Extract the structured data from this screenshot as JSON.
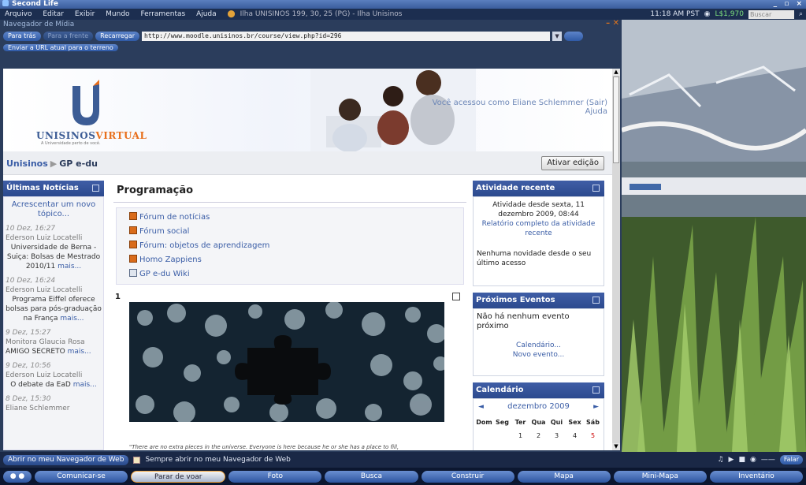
{
  "app": {
    "title": "Second Life",
    "window_controls": "_ ▫ ×"
  },
  "menubar": {
    "items": [
      "Arquivo",
      "Editar",
      "Exibir",
      "Mundo",
      "Ferramentas",
      "Ajuda"
    ],
    "location": "Ilha UNISINOS 199, 30, 25 (PG) - Ilha Unisinos",
    "time": "11:18 AM PST",
    "money": "L$1,970",
    "search_placeholder": "Buscar"
  },
  "media_browser": {
    "title": "Navegador de Mídia",
    "back": "Para trás",
    "forward": "Para a frente",
    "reload": "Recarregar",
    "url": "http://www.moodle.unisinos.br/course/view.php?id=296",
    "send_url": "Enviar a URL atual para o terreno"
  },
  "moodle": {
    "logo": "UNISINOS",
    "logo_accent": "VIRTUAL",
    "logo_sub": "A Universidade perto de você.",
    "user_line": "Você acessou como Eliane Schlemmer (Sair)",
    "help": "Ajuda",
    "breadcrumb_home": "Unisinos",
    "breadcrumb_sep": "▶",
    "breadcrumb_course": "GP e-du",
    "edit_button": "Ativar edição",
    "news": {
      "title": "Últimas Notícias",
      "add": "Acrescentar um novo tópico...",
      "items": [
        {
          "date": "10 Dez, 16:27",
          "author": "Ederson Luiz Locatelli",
          "text": "Universidade de Berna - Suiça: Bolsas de Mestrado 2010/11",
          "more": "mais..."
        },
        {
          "date": "10 Dez, 16:24",
          "author": "Ederson Luiz Locatelli",
          "text": "Programa Eiffel oferece bolsas para pós-graduação na França",
          "more": "mais..."
        },
        {
          "date": "9 Dez, 15:27",
          "author": "Monitora Glaucia Rosa",
          "text": "AMIGO SECRETO",
          "more": "mais..."
        },
        {
          "date": "9 Dez, 10:56",
          "author": "Ederson Luiz Locatelli",
          "text": "O debate da EaD",
          "more": "mais..."
        },
        {
          "date": "8 Dez, 15:30",
          "author": "Eliane Schlemmer",
          "text": "",
          "more": ""
        }
      ]
    },
    "main_title": "Programação",
    "forums": [
      "Fórum de notícias",
      "Fórum social",
      "Fórum: objetos de aprendizagem",
      "Homo Zappiens",
      "GP e-du Wiki"
    ],
    "section_number": "1",
    "quote": "\"There are no extra pieces in the universe. Everyone is here because he or she has a place to fill,",
    "recent": {
      "title": "Atividade recente",
      "since": "Atividade desde sexta, 11 dezembro 2009, 08:44",
      "full_report": "Relatório completo da atividade recente",
      "none": "Nenhuma novidade desde o seu último acesso"
    },
    "events": {
      "title": "Próximos Eventos",
      "none": "Não há nenhum evento próximo",
      "calendar": "Calendário...",
      "new": "Novo evento..."
    },
    "calendar": {
      "title": "Calendário",
      "month": "dezembro 2009",
      "prev": "◄",
      "next": "►",
      "days": [
        "Dom",
        "Seg",
        "Ter",
        "Qua",
        "Qui",
        "Sex",
        "Sáb"
      ],
      "week1": [
        "",
        "",
        "1",
        "2",
        "3",
        "4",
        "5"
      ]
    }
  },
  "statusbar": {
    "open_web": "Abrir no meu Navegador de Web",
    "always_open": "Sempre abrir no meu Navegador de Web",
    "speak": "Falar"
  },
  "toolbar": {
    "buttons": [
      "Comunicar-se",
      "Parar de voar",
      "Foto",
      "Busca",
      "Construir",
      "Mapa",
      "Mini-Mapa",
      "Inventário"
    ]
  },
  "colors": {
    "accent_blue": "#3f5ea6",
    "logo_orange": "#e86f1c",
    "money_green": "#7ce07c"
  }
}
